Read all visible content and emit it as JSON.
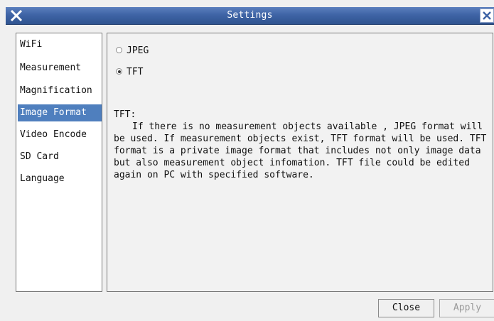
{
  "window": {
    "title": "Settings"
  },
  "sidebar": {
    "items": [
      {
        "label": "WiFi"
      },
      {
        "label": "Measurement"
      },
      {
        "label": "Magnification"
      },
      {
        "label": "Image Format",
        "active": true
      },
      {
        "label": "Video Encode"
      },
      {
        "label": "SD Card"
      },
      {
        "label": "Language"
      }
    ]
  },
  "image_format": {
    "options": [
      {
        "label": "JPEG",
        "checked": false
      },
      {
        "label": "TFT",
        "checked": true
      }
    ],
    "description_title": "TFT:",
    "description_body": "If there is no measurement objects available , JPEG format will be used. If measurement objects exist, TFT format will be used.  TFT format is a private image format that includes not only image data but also measurement object infomation. TFT file could be edited again on PC with specified software."
  },
  "footer": {
    "close_label": "Close",
    "apply_label": "Apply"
  },
  "colors": {
    "titlebar": "#3f64a6",
    "selection": "#4f7fbe"
  },
  "icons": {
    "app": "app-x-icon",
    "close": "close-x-icon"
  }
}
